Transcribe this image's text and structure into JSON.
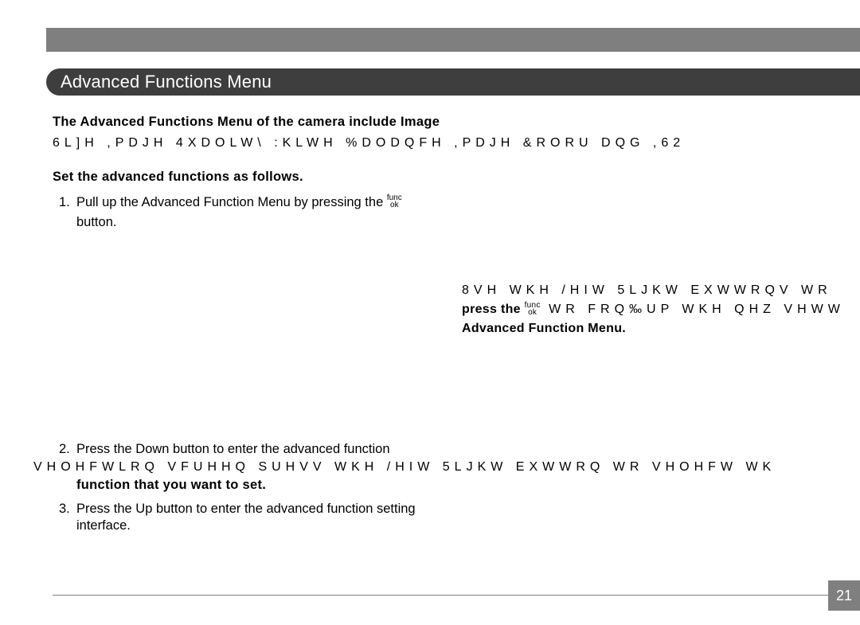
{
  "title": "Advanced Functions Menu",
  "intro_line": "The Advanced Functions Menu of the camera include Image",
  "garble_line1": "6L]H ,PDJH 4XDOLW\\ :KLWH %DODQFH ,PDJH &RORU DQG ,62",
  "set_line": "Set the advanced functions as follows.",
  "step1_num": "1.",
  "step1_text_a": "Pull up the Advanced Function Menu by pressing the ",
  "func_top": "func",
  "func_bot": "ok",
  "step1_text_b": "button.",
  "float_garble": "8VH WKH /HIW 5LJKW EXWWRQV WR",
  "float_press_a": "press the ",
  "float_press_garble": " WR FRQ‰UP WKH QHZ VHWW",
  "float_adv": "Advanced Function Menu.",
  "step2_num": "2.",
  "step2_line1": "Press the Down button to enter the advanced function",
  "step2_garble": "VHOHFWLRQ VFUHHQ  SUHVV WKH /HIW 5LJKW EXWWRQ WR VHOHFW WK",
  "step2_line3": "function that you want to set.",
  "step3_num": "3.",
  "step3_line1": "Press the Up button to enter the advanced function setting",
  "step3_line2": "interface.",
  "page_number": "21"
}
